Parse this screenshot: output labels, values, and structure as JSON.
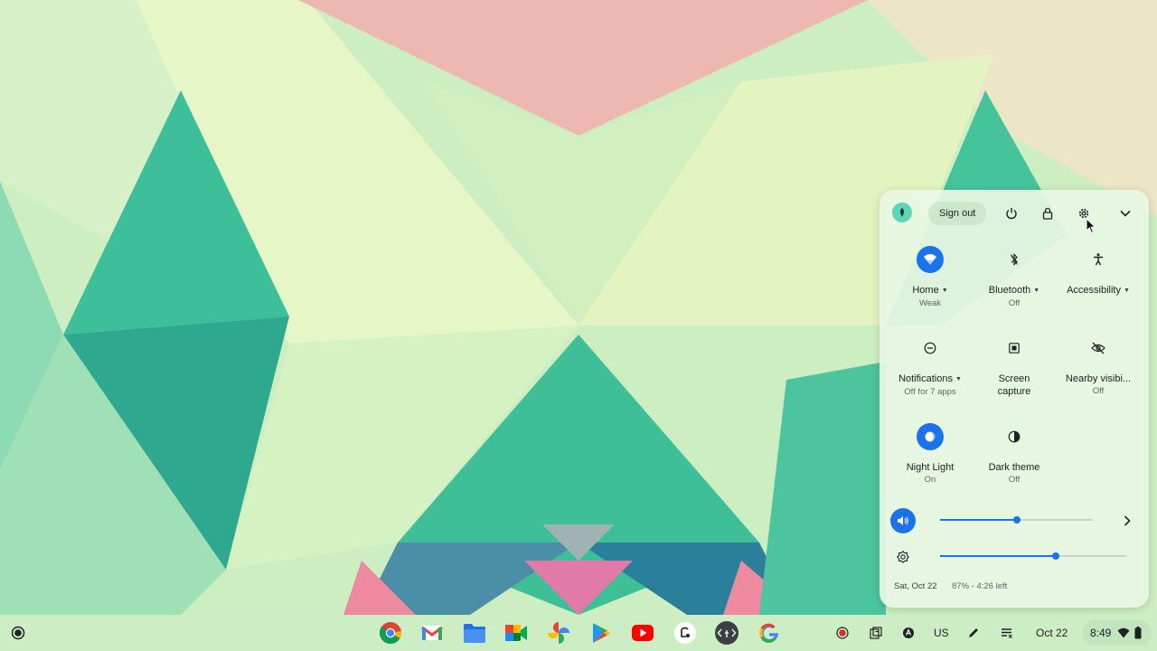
{
  "quick_settings": {
    "header": {
      "sign_out_label": "Sign out"
    },
    "tiles": [
      {
        "label": "Home",
        "sub": "Weak",
        "icon": "wifi-icon",
        "active": true,
        "has_menu": true
      },
      {
        "label": "Bluetooth",
        "sub": "Off",
        "icon": "bluetooth-icon",
        "active": false,
        "has_menu": true
      },
      {
        "label": "Accessibility",
        "sub": "",
        "icon": "accessibility-icon",
        "active": false,
        "has_menu": true
      },
      {
        "label": "Notifications",
        "sub": "Off for 7 apps",
        "icon": "do-not-disturb-icon",
        "active": false,
        "has_menu": true
      },
      {
        "label_line1": "Screen",
        "label_line2": "capture",
        "icon": "screen-capture-icon",
        "active": false
      },
      {
        "label": "Nearby visibi...",
        "sub": "Off",
        "icon": "nearby-visibility-icon",
        "active": false
      },
      {
        "label": "Night Light",
        "sub": "On",
        "icon": "night-light-icon",
        "active": true
      },
      {
        "label": "Dark theme",
        "sub": "Off",
        "icon": "dark-theme-icon",
        "active": false
      }
    ],
    "volume_level": 0.5,
    "brightness_level": 0.62,
    "footer": {
      "date": "Sat, Oct 22",
      "battery": "87% - 4:26 left"
    }
  },
  "shelf": {
    "apps": [
      "Chrome",
      "Gmail",
      "Files",
      "Google Meet",
      "Google Photos",
      "Play Store",
      "YouTube",
      "Screencast",
      "Terminal",
      "Google"
    ],
    "tray": {
      "ime": "US",
      "date": "Oct 22",
      "time": "8:49"
    }
  },
  "colors": {
    "accent": "#1a73e8",
    "panel": "#e8f6e2"
  }
}
